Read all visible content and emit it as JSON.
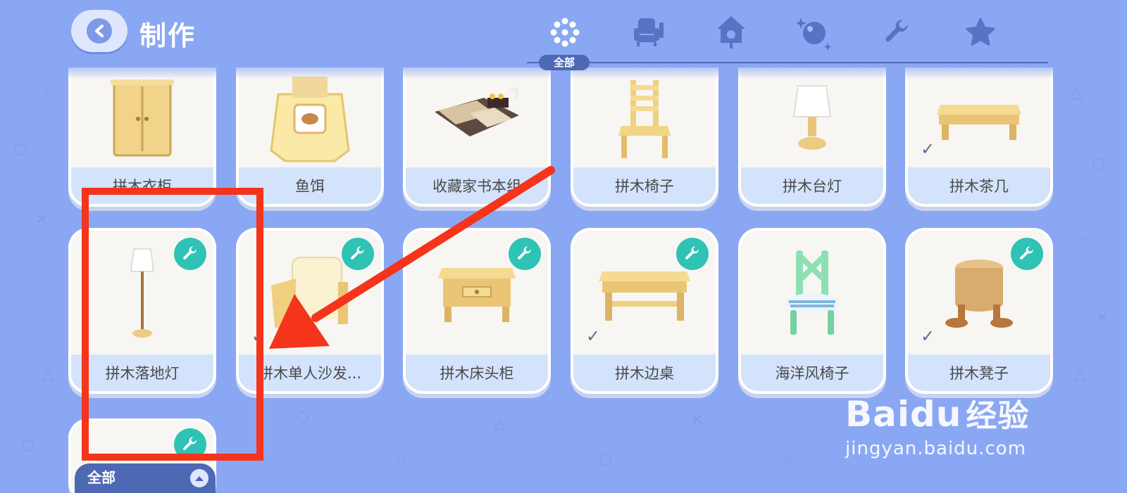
{
  "header": {
    "title": "制作",
    "active_tab_label": "全部",
    "tabs": [
      {
        "icon": "all-dots-icon"
      },
      {
        "icon": "armchair-icon"
      },
      {
        "icon": "cuckoo-clock-icon"
      },
      {
        "icon": "orb-icon"
      },
      {
        "icon": "wrench-icon"
      },
      {
        "icon": "star-icon"
      }
    ]
  },
  "items_row1": [
    {
      "label": "拼木衣柜",
      "checked": false
    },
    {
      "label": "鱼饵",
      "checked": false
    },
    {
      "label": "收藏家书本组",
      "checked": false
    },
    {
      "label": "拼木椅子",
      "checked": false
    },
    {
      "label": "拼木台灯",
      "checked": false
    },
    {
      "label": "拼木茶几",
      "checked": true
    }
  ],
  "items_row2": [
    {
      "label": "拼木落地灯",
      "checked": false,
      "badge": "wrench-badge-icon"
    },
    {
      "label": "拼木单人沙发...",
      "checked": true,
      "badge": "wrench-badge-icon"
    },
    {
      "label": "拼木床头柜",
      "checked": false,
      "badge": "wrench-badge-icon"
    },
    {
      "label": "拼木边桌",
      "checked": true,
      "badge": "wrench-badge-icon"
    },
    {
      "label": "海洋风椅子",
      "checked": false,
      "badge": "wrench-badge-icon"
    },
    {
      "label": "拼木凳子",
      "checked": true,
      "badge": "wrench-badge-icon"
    }
  ],
  "filter": {
    "label": "全部"
  },
  "watermark": {
    "logo_latin": "Bai",
    "logo_paw": "du",
    "logo_cn": "经验",
    "url": "jingyan.baidu.com"
  },
  "colors": {
    "background": "#8aa7f3",
    "card_label_bg": "#d3e3fb",
    "badge": "#2ec3b4",
    "annotation_red": "#f4341b",
    "filter_bg": "#4e69b3"
  }
}
